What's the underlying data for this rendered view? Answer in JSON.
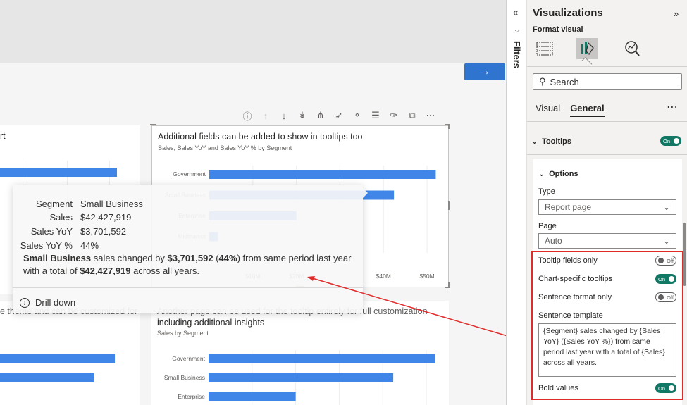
{
  "canvas": {
    "next_button_icon": "arrow-right-icon",
    "toolbar_icons": [
      "help-icon",
      "arrow-up-icon",
      "arrow-down-icon",
      "double-arrow-down-icon",
      "drill-icon",
      "pin-icon",
      "bell-icon",
      "filter-icon",
      "analytics-icon",
      "focus-icon",
      "more-icon"
    ],
    "card_left_top_title": "rt",
    "card_main": {
      "title": "Additional fields can be added to show in tooltips too",
      "subtitle": "Sales, Sales YoY and Sales YoY % by Segment",
      "categories": [
        "Government",
        "Small Business",
        "Enterprise",
        "Midmarket"
      ],
      "ticks": [
        "$10M",
        "$20M",
        "$40M",
        "$50M"
      ]
    },
    "card_left_bottom_text": "e theme and can be customized for",
    "card_bottom": {
      "title_line1": "Another page can be used for the tooltip entirely for full customization",
      "title_line2": "including additional insights",
      "subtitle": "Sales by Segment",
      "categories": [
        "Government",
        "Small Business",
        "Enterprise"
      ]
    }
  },
  "chart_data": [
    {
      "type": "bar",
      "title": "Additional fields can be added to show in tooltips too",
      "subtitle": "Sales, Sales YoY and Sales YoY % by Segment",
      "categories": [
        "Government",
        "Small Business",
        "Enterprise",
        "Midmarket"
      ],
      "values": [
        52,
        42.4,
        20,
        2
      ],
      "units": "$M"
    },
    {
      "type": "bar",
      "title": "Another page can be used for the tooltip entirely for full customization including additional insights",
      "subtitle": "Sales by Segment",
      "categories": [
        "Government",
        "Small Business",
        "Enterprise"
      ],
      "values": [
        52,
        42.4,
        20
      ],
      "units": "$M"
    }
  ],
  "tooltip": {
    "rows": [
      {
        "label": "Segment",
        "value": "Small Business"
      },
      {
        "label": "Sales",
        "value": "$42,427,919"
      },
      {
        "label": "Sales YoY",
        "value": "$3,701,592"
      },
      {
        "label": "Sales YoY %",
        "value": "44%"
      }
    ],
    "sentence": {
      "segment": "Small Business",
      "part1": " sales changed by ",
      "yoy": "$3,701,592",
      "part2": " (",
      "pct": "44%",
      "part3": ") from same period last year with a total of ",
      "sales": "$42,427,919",
      "part4": " across all years."
    },
    "drill_label": "Drill down"
  },
  "filters": {
    "label": "Filters"
  },
  "panel": {
    "title": "Visualizations",
    "subtitle": "Format visual",
    "search_placeholder": "Search",
    "tabs": [
      "Visual",
      "General"
    ],
    "tooltips_label": "Tooltips",
    "tooltips_toggle": "On",
    "options_label": "Options",
    "type_label": "Type",
    "type_value": "Report page",
    "page_label": "Page",
    "page_value": "Auto",
    "tooltip_fields_only_label": "Tooltip fields only",
    "tooltip_fields_only_toggle": "Off",
    "chart_specific_label": "Chart-specific tooltips",
    "chart_specific_toggle": "On",
    "sentence_format_label": "Sentence format only",
    "sentence_format_toggle": "Off",
    "sentence_template_label": "Sentence template",
    "sentence_template_value": "{Segment} sales changed by {Sales YoY} ({Sales YoY %}) from same period last year with a total of {Sales} across all years.",
    "bold_values_label": "Bold values",
    "bold_values_toggle": "On"
  },
  "colors": {
    "bar": "#3f86e8",
    "accent_toggle": "#117865",
    "highlight_border": "#e02b2b"
  }
}
